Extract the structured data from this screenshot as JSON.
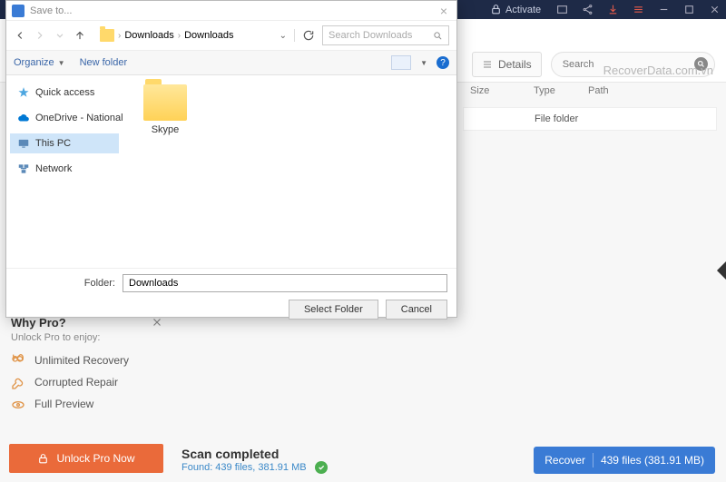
{
  "bg": {
    "activate": "Activate",
    "details": "Details",
    "search_placeholder": "Search",
    "watermark": "RecoverData.com.vn",
    "headers": {
      "size": "Size",
      "type": "Type",
      "path": "Path"
    },
    "row": {
      "type": "File folder"
    }
  },
  "whypro": {
    "title": "Why Pro?",
    "sub": "Unlock Pro to enjoy:",
    "feat1": "Unlimited Recovery",
    "feat2": "Corrupted Repair",
    "feat3": "Full Preview",
    "unlock": "Unlock Pro Now"
  },
  "scan": {
    "title": "Scan completed",
    "sub": "Found: 439 files, 381.91 MB"
  },
  "recover": {
    "label": "Recover",
    "count": "439 files (381.91 MB)"
  },
  "dialog": {
    "title": "Save to...",
    "path1": "Downloads",
    "path2": "Downloads",
    "search_placeholder": "Search Downloads",
    "organize": "Organize",
    "newfolder": "New folder",
    "side": {
      "quick": "Quick access",
      "onedrive": "OneDrive - National I",
      "thispc": "This PC",
      "network": "Network"
    },
    "folder1": "Skype",
    "folder_label": "Folder:",
    "folder_value": "Downloads",
    "select": "Select Folder",
    "cancel": "Cancel"
  }
}
